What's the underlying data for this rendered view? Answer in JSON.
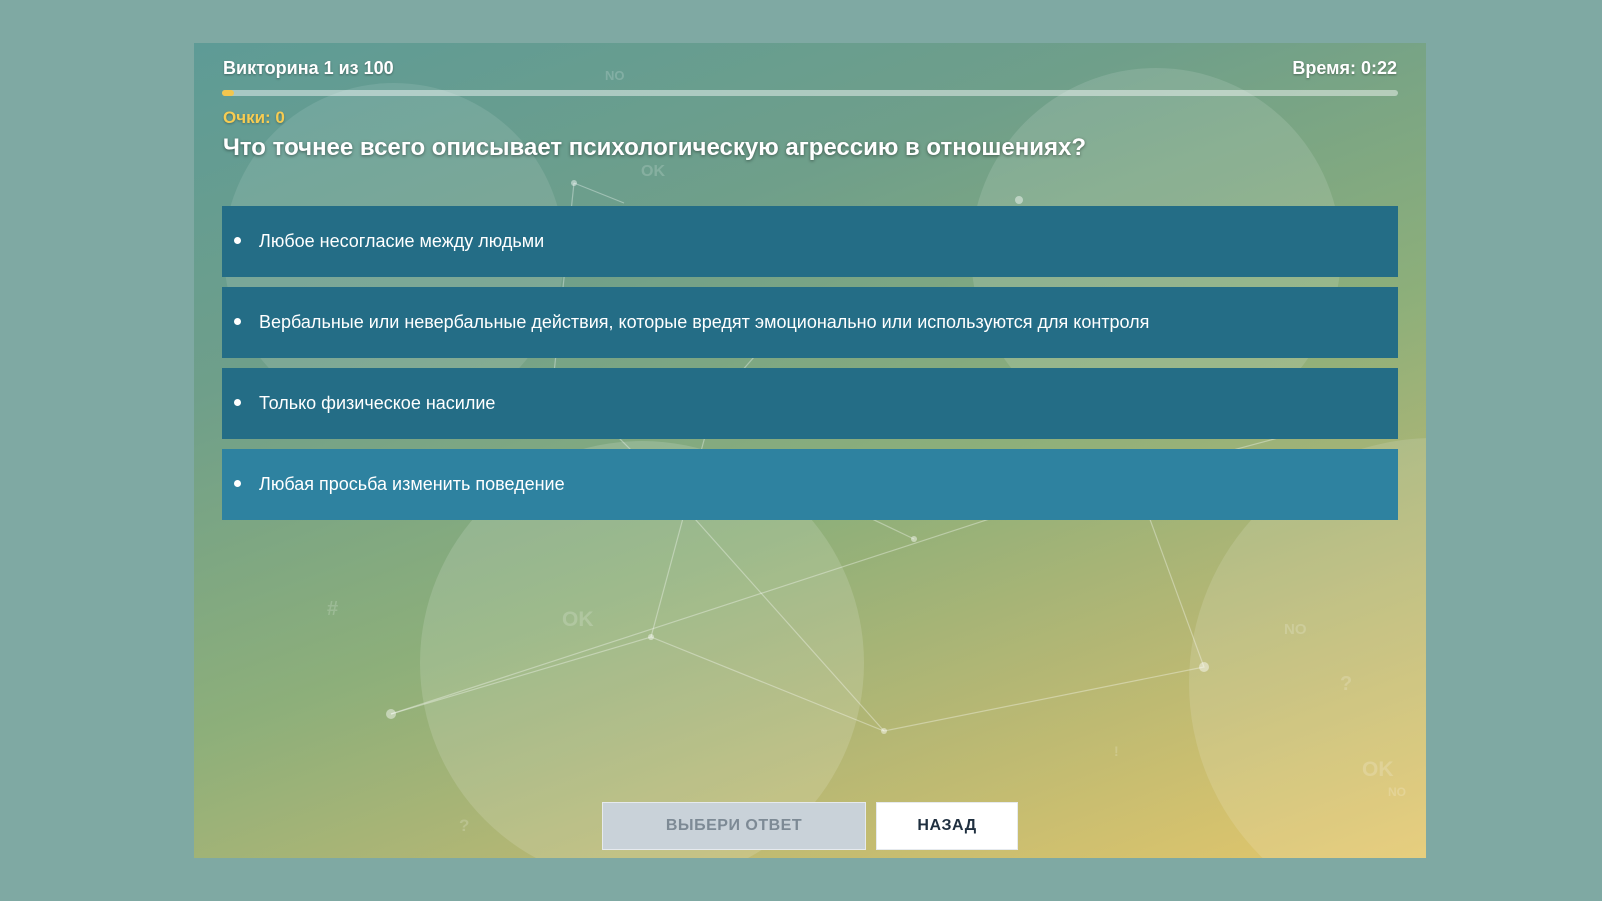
{
  "header": {
    "quiz_progress_label": "Викторина 1 из 100",
    "timer_label": "Время: 0:22"
  },
  "progress": {
    "current": 1,
    "total": 100,
    "fraction": 0.01
  },
  "score_label": "Очки: 0",
  "question": "Что точнее всего описывает психологическую агрессию в отношениях?",
  "answers": [
    {
      "label": "Любое несогласие между людьми"
    },
    {
      "label": "Вербальные или невербальные действия, которые вредят эмоционально или используются для контроля"
    },
    {
      "label": "Только физическое насилие"
    },
    {
      "label": "Любая просьба изменить поведение"
    }
  ],
  "buttons": {
    "submit_label": "ВЫБЕРИ ОТВЕТ",
    "back_label": "НАЗАД"
  },
  "background_words": [
    "NO",
    "OK",
    "#",
    "OK",
    "NO",
    "?",
    "OK",
    "NO",
    "?",
    "!"
  ],
  "colors": {
    "answer": "#246d86",
    "answer_hover": "#2e82a0",
    "score": "#f6cc52",
    "progress_fill": "#f3c64d"
  }
}
